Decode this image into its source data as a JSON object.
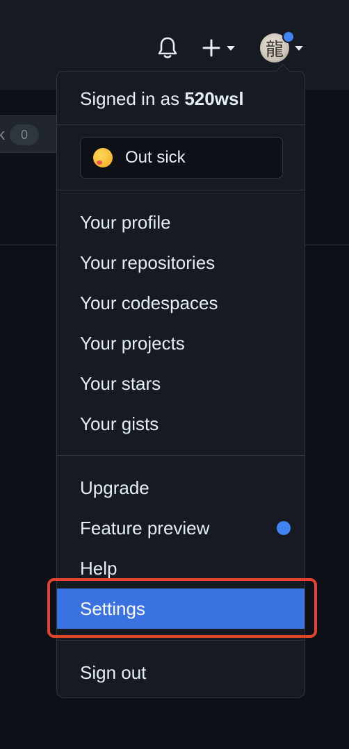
{
  "header": {
    "notifications_icon": "bell-icon",
    "create_icon": "plus-icon",
    "avatar_glyph": "龍",
    "status_dot_color": "#4185f4"
  },
  "background": {
    "counter_fragment": "k",
    "counter_value": "0"
  },
  "menu": {
    "signed_in_prefix": "Signed in as",
    "username": "520wsl",
    "status_emoji": "woozy-face",
    "status_text": "Out sick",
    "items": [
      {
        "label": "Your profile"
      },
      {
        "label": "Your repositories"
      },
      {
        "label": "Your codespaces"
      },
      {
        "label": "Your projects"
      },
      {
        "label": "Your stars"
      },
      {
        "label": "Your gists"
      },
      {
        "label": "Upgrade"
      },
      {
        "label": "Feature preview"
      },
      {
        "label": "Help"
      },
      {
        "label": "Settings"
      },
      {
        "label": "Sign out"
      }
    ],
    "active_item": "Settings",
    "highlight_color": "#e2432f",
    "active_color": "#3a72e1"
  }
}
